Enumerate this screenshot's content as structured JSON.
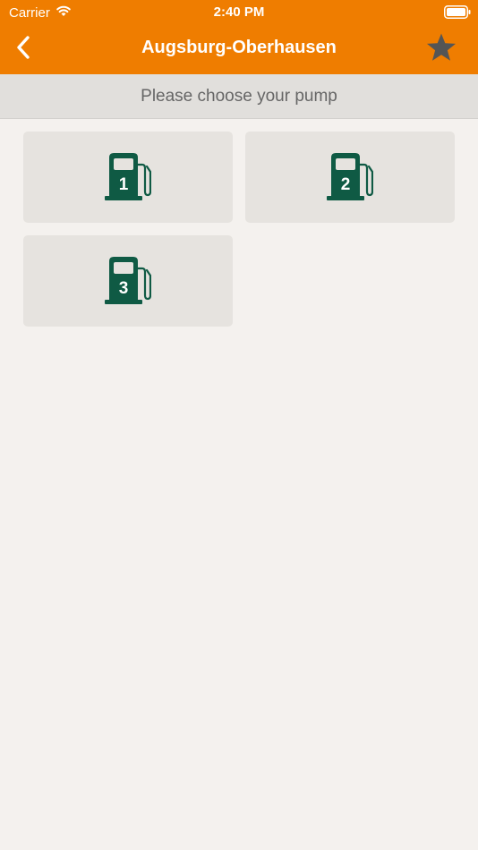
{
  "status_bar": {
    "carrier": "Carrier",
    "time": "2:40 PM"
  },
  "nav": {
    "title": "Augsburg-Oberhausen",
    "back_icon": "chevron-left-icon",
    "favorite_icon": "star-icon"
  },
  "subheader": {
    "text": "Please choose your pump"
  },
  "pumps": [
    {
      "number": "1",
      "icon": "fuel-pump-icon"
    },
    {
      "number": "2",
      "icon": "fuel-pump-icon"
    },
    {
      "number": "3",
      "icon": "fuel-pump-icon"
    }
  ],
  "colors": {
    "header": "#ef7d00",
    "pump_icon": "#0f5a44",
    "star": "#555555",
    "background": "#f4f1ee"
  }
}
